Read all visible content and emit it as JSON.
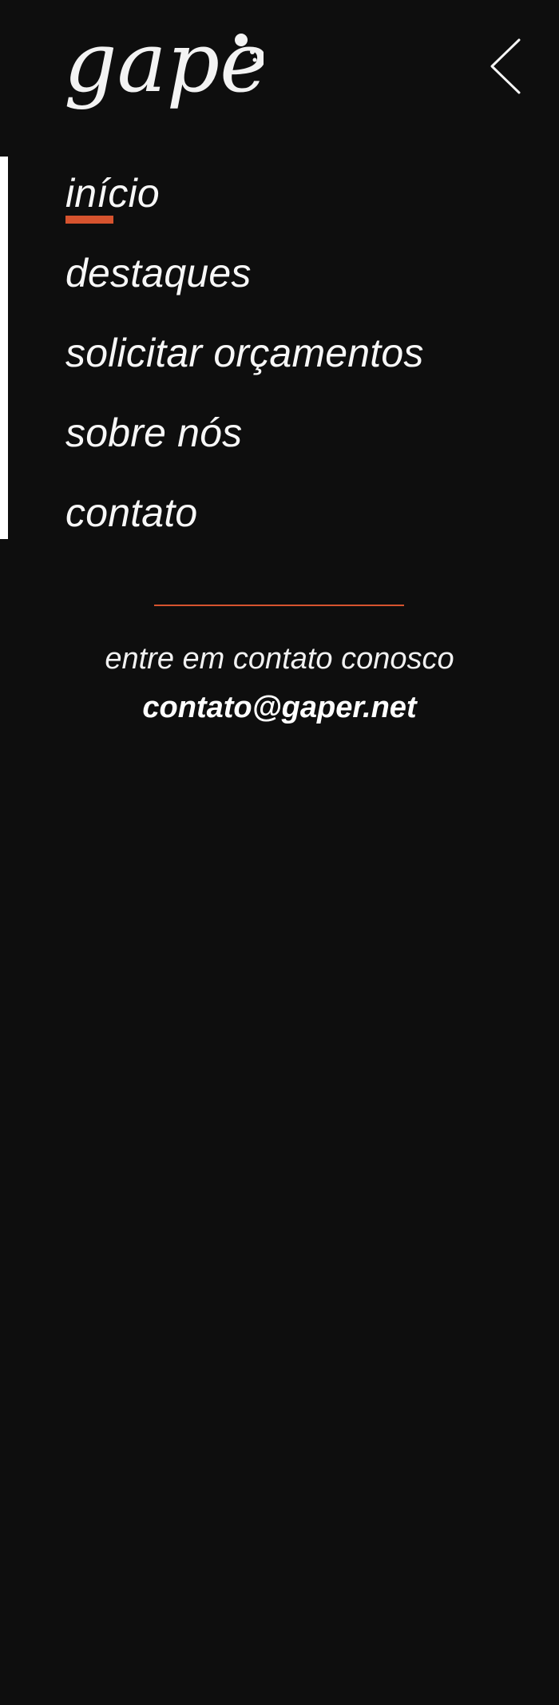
{
  "header": {
    "logo_text": "gaper",
    "back_icon": "chevron-left-icon"
  },
  "nav": {
    "items": [
      {
        "label": "início",
        "active": true
      },
      {
        "label": "destaques",
        "active": false
      },
      {
        "label": "solicitar orçamentos",
        "active": false
      },
      {
        "label": "sobre nós",
        "active": false
      },
      {
        "label": "contato",
        "active": false
      }
    ]
  },
  "contact": {
    "prompt": "entre em contato conosco",
    "email": "contato@gaper.net"
  },
  "colors": {
    "background": "#0e0e0e",
    "accent": "#d6532e",
    "text": "#f5f5f5"
  }
}
